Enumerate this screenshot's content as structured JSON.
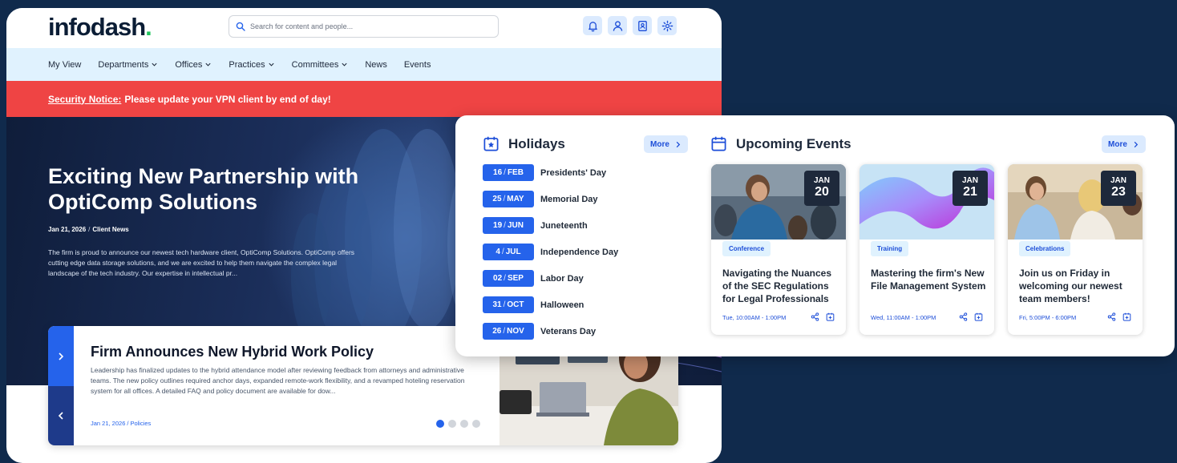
{
  "header": {
    "logo_text": "infodash",
    "logo_dot": ".",
    "search_placeholder": "Search for content and people...",
    "icons": [
      "bell-icon",
      "user-icon",
      "contact-book-icon",
      "gear-icon"
    ]
  },
  "nav": {
    "items": [
      "My View",
      "Departments",
      "Offices",
      "Practices",
      "Committees",
      "News",
      "Events"
    ]
  },
  "alert": {
    "label": "Security Notice:",
    "message": "Please update your VPN client by end of day!"
  },
  "hero": {
    "title": "Exciting New Partnership with OptiComp Solutions",
    "date": "Jan 21, 2026",
    "separator": "/",
    "category": "Client News",
    "body": "The firm is proud to announce our newest tech hardware client, OptiComp Solutions. OptiComp offers cutting edge data storage solutions, and we are excited to help them navigate the complex legal landscape of the tech industry. Our expertise in intellectual pr..."
  },
  "news_card": {
    "title": "Firm Announces New Hybrid Work Policy",
    "body": "Leadership has finalized updates to the hybrid attendance model after reviewing feedback from attorneys and administrative teams. The new policy outlines required anchor days, expanded remote-work flexibility, and a revamped hoteling reservation system for all offices. A detailed FAQ and policy document are available for dow...",
    "date": "Jan 21, 2026",
    "separator": "/",
    "category": "Policies",
    "slide_count": 4,
    "active_slide": 1
  },
  "holidays": {
    "title": "Holidays",
    "more_label": "More",
    "items": [
      {
        "day": "16",
        "month": "FEB",
        "name": "Presidents' Day"
      },
      {
        "day": "25",
        "month": "MAY",
        "name": "Memorial Day"
      },
      {
        "day": "19",
        "month": "JUN",
        "name": "Juneteenth"
      },
      {
        "day": "4",
        "month": "JUL",
        "name": "Independence Day"
      },
      {
        "day": "02",
        "month": "SEP",
        "name": "Labor Day"
      },
      {
        "day": "31",
        "month": "OCT",
        "name": "Halloween"
      },
      {
        "day": "26",
        "month": "NOV",
        "name": "Veterans Day"
      }
    ]
  },
  "events": {
    "title": "Upcoming Events",
    "more_label": "More",
    "items": [
      {
        "month": "JAN",
        "day": "20",
        "tag": "Conference",
        "title": "Navigating the Nuances of the SEC Regulations for Legal Professionals",
        "time": "Tue, 10:00AM - 1:00PM"
      },
      {
        "month": "JAN",
        "day": "21",
        "tag": "Training",
        "title": "Mastering the firm's New File Management System",
        "time": "Wed, 11:00AM - 1:00PM"
      },
      {
        "month": "JAN",
        "day": "23",
        "tag": "Celebrations",
        "title": "Join us on Friday in welcoming our newest team members!",
        "time": "Fri, 5:00PM - 6:00PM"
      }
    ]
  },
  "colors": {
    "page_bg": "#102a4c",
    "accent": "#2563eb",
    "alert": "#ef4444",
    "nav_bg": "#e0f2fe",
    "logo_dot": "#22c55e"
  }
}
